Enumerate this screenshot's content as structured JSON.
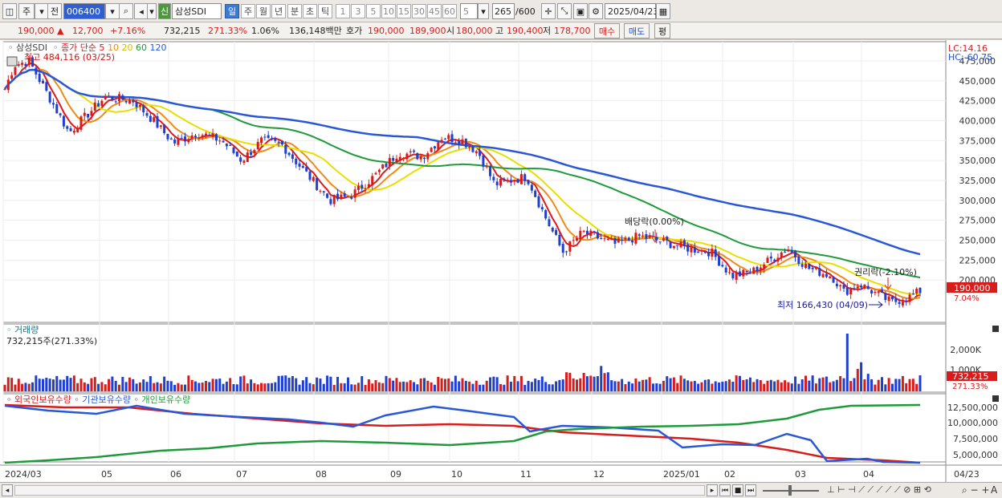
{
  "toolbar": {
    "market": "주",
    "prev": "전",
    "code": "006400",
    "credit": "신",
    "stock_name": "삼성SDI",
    "periods": [
      "일",
      "주",
      "월",
      "년",
      "분",
      "초",
      "틱"
    ],
    "active_period": "일",
    "minute_options": [
      "1",
      "3",
      "5",
      "10",
      "15",
      "30",
      "45",
      "60"
    ],
    "interval": "5",
    "count": "265",
    "count_max": "/600",
    "date": "2025/04/23"
  },
  "quote": {
    "price": "190,000",
    "change": "12,700",
    "change_pct": "+7.16%",
    "volume": "732,215",
    "volume_ratio": "271.33%",
    "turnover": "1.06%",
    "amount": "136,148백만",
    "ask_label": "호가",
    "ask1": "190,000",
    "ask2": "189,900",
    "open_label": "시",
    "open": "180,000",
    "high_label": "고",
    "high": "190,400",
    "low_label": "저",
    "low": "178,700",
    "buy": "매수",
    "sell": "매도",
    "avg": "평"
  },
  "price_panel": {
    "name": "삼성SDI",
    "legend_prefix": "종가 단순",
    "ma": [
      {
        "label": "5",
        "color": "#e01818"
      },
      {
        "label": "10",
        "color": "#f08a18"
      },
      {
        "label": "20",
        "color": "#e0d000"
      },
      {
        "label": "60",
        "color": "#1f9a3a"
      },
      {
        "label": "120",
        "color": "#2857d8"
      }
    ],
    "high_note": "최고 484,116 (03/25)",
    "low_note": "최저 166,430 (04/09)",
    "div_note": "배당락(0.00%)",
    "rights_note": "권리락(-2.10%)",
    "lc": "LC:14.16",
    "hc": "HC:-60.75",
    "current_price": "190,000",
    "current_pct": "7.04%",
    "yticks": [
      "475,000",
      "450,000",
      "425,000",
      "400,000",
      "375,000",
      "350,000",
      "325,000",
      "300,000",
      "275,000",
      "250,000",
      "225,000",
      "200,000"
    ]
  },
  "volume_panel": {
    "title": "거래량",
    "value": "732,215주(271.33%)",
    "yticks": [
      "2,000K",
      "1,000K"
    ],
    "current": "732,215",
    "current_pct": "271.33%"
  },
  "holding_panel": {
    "legend": [
      {
        "label": "외국인보유수량",
        "color": "#e01818"
      },
      {
        "label": "기관보유수량",
        "color": "#2857d8"
      },
      {
        "label": "개인보유수량",
        "color": "#1f9a3a"
      }
    ],
    "yticks": [
      "12,500,000",
      "10,000,000",
      "7,500,000",
      "5,000,000"
    ]
  },
  "xaxis": [
    "2024/03",
    "05",
    "06",
    "07",
    "08",
    "09",
    "10",
    "11",
    "12",
    "2025/01",
    "02",
    "03",
    "04",
    "04/23"
  ],
  "chart_data": {
    "type": "line",
    "title": "삼성SDI",
    "xlabel": "",
    "ylabel": "",
    "x": [
      "2024/03",
      "05",
      "06",
      "07",
      "08",
      "09",
      "10",
      "11",
      "12",
      "2025/01",
      "02",
      "03",
      "04",
      "04/23"
    ],
    "ylim": [
      166430,
      484116
    ],
    "series": [
      {
        "name": "종가 단순 5",
        "values": [
          460000,
          415000,
          400000,
          365000,
          345000,
          310000,
          375000,
          340000,
          245000,
          240000,
          220000,
          215000,
          180000,
          190000
        ]
      },
      {
        "name": "종가 단순 120",
        "values": [
          425000,
          418000,
          410000,
          398000,
          385000,
          368000,
          360000,
          345000,
          315000,
          292000,
          270000,
          250000,
          233000,
          228000
        ]
      }
    ],
    "high": 484116,
    "high_date": "03/25",
    "low": 166430,
    "low_date": "04/09",
    "last": 190000
  }
}
